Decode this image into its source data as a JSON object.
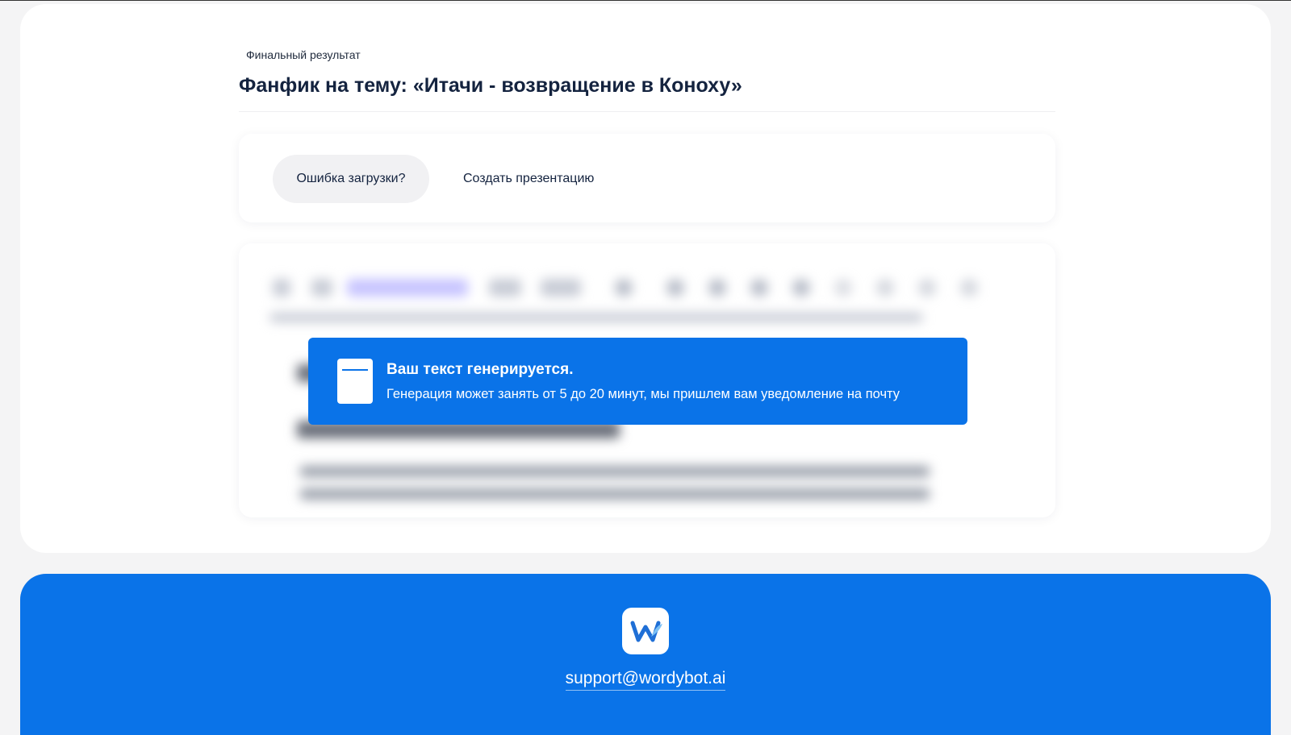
{
  "result": {
    "subtitle": "Финальный результат",
    "title": "Фанфик на тему: «Итачи - возвращение в Коноху»"
  },
  "actions": {
    "error_label": "Ошибка загрузки?",
    "presentation_label": "Создать презентацию"
  },
  "notice": {
    "icon": "notepad-icon",
    "title": "Ваш текст генерируется.",
    "text": "Генерация может занять от 5 до 20 минут, мы пришлем вам уведомление на почту"
  },
  "footer": {
    "logo_icon": "wordybot-logo-icon",
    "email": "support@wordybot.ai"
  },
  "colors": {
    "accent": "#0a73e8",
    "title": "#14233f",
    "card": "#ffffff",
    "page_bg": "#f4f4f5"
  }
}
